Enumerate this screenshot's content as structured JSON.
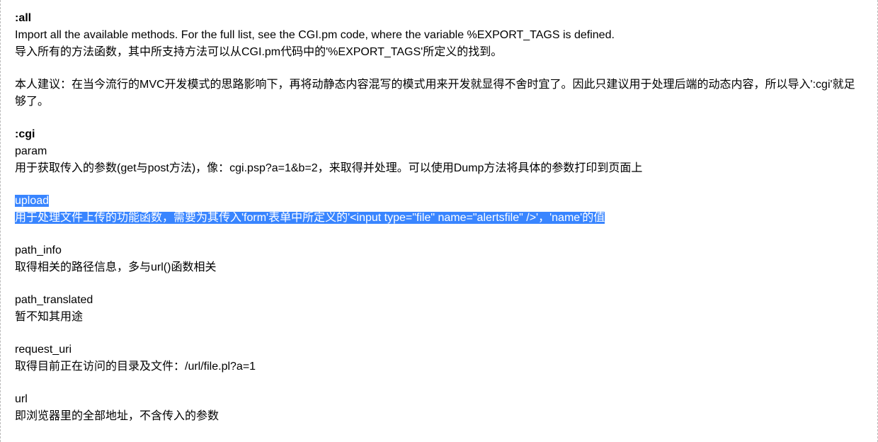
{
  "sections": [
    {
      "lines": [
        {
          "text": ":all",
          "bold": true
        },
        {
          "text": "Import all the available methods. For the full list, see the CGI.pm code, where the variable %EXPORT_TAGS is defined."
        },
        {
          "text": "导入所有的方法函数，其中所支持方法可以从CGI.pm代码中的'%EXPORT_TAGS'所定义的找到。"
        }
      ]
    },
    {
      "lines": [
        {
          "text": "本人建议：在当今流行的MVC开发模式的思路影响下，再将动静态内容混写的模式用来开发就显得不舍时宜了。因此只建议用于处理后端的动态内容，所以导入':cgi'就足够了。"
        }
      ]
    },
    {
      "lines": [
        {
          "text": ":cgi",
          "bold": true
        },
        {
          "text": "param"
        },
        {
          "text": "用于获取传入的参数(get与post方法)，像：cgi.psp?a=1&b=2，来取得并处理。可以使用Dump方法将具体的参数打印到页面上"
        }
      ]
    },
    {
      "lines": [
        {
          "text": "upload",
          "highlight": true
        },
        {
          "text": "用于处理文件上传的功能函数，需要为其传入'form'表单中所定义的'<input type=\"file\" name=\"alertsfile\" />'，'name'的值",
          "highlight": true
        }
      ]
    },
    {
      "lines": [
        {
          "text": "path_info"
        },
        {
          "text": "取得相关的路径信息，多与url()函数相关"
        }
      ]
    },
    {
      "lines": [
        {
          "text": "path_translated"
        },
        {
          "text": "暂不知其用途"
        }
      ]
    },
    {
      "lines": [
        {
          "text": "request_uri"
        },
        {
          "text": "取得目前正在访问的目录及文件：/url/file.pl?a=1"
        }
      ]
    },
    {
      "lines": [
        {
          "text": "url"
        },
        {
          "text": "即浏览器里的全部地址，不含传入的参数"
        }
      ]
    }
  ]
}
